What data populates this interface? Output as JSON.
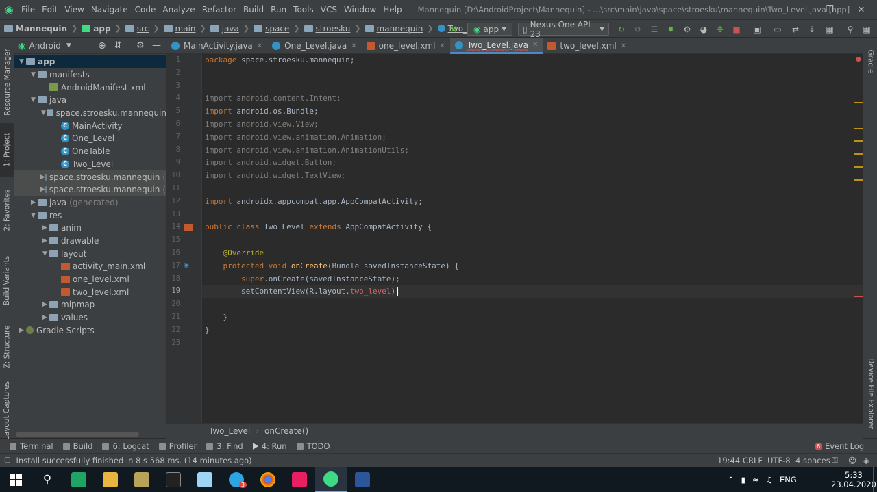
{
  "menubar": {
    "items": [
      "File",
      "Edit",
      "View",
      "Navigate",
      "Code",
      "Analyze",
      "Refactor",
      "Build",
      "Run",
      "Tools",
      "VCS",
      "Window",
      "Help"
    ],
    "window_title": "Mannequin [D:\\AndroidProject\\Mannequin] - ...\\src\\main\\java\\space\\stroesku\\mannequin\\Two_Level.java [app]"
  },
  "navbar": {
    "breadcrumbs": [
      "Mannequin",
      "app",
      "src",
      "main",
      "java",
      "space",
      "stroesku",
      "mannequin",
      "Two_Level"
    ],
    "run_config": "app",
    "device": "Nexus One API 23"
  },
  "sidebar_left": {
    "tabs": [
      "Resource Manager",
      "1: Project",
      "2: Favorites",
      "Build Variants",
      "Z: Structure",
      "Layout Captures"
    ]
  },
  "sidebar_right": {
    "tabs": [
      "Gradle",
      "Device File Explorer"
    ]
  },
  "project": {
    "view_mode": "Android",
    "tree": [
      {
        "label": "app",
        "suffix": "",
        "level": 0,
        "arrow": "down",
        "icon": "folder"
      },
      {
        "label": "manifests",
        "suffix": "",
        "level": 1,
        "arrow": "down",
        "icon": "folder"
      },
      {
        "label": "AndroidManifest.xml",
        "suffix": "",
        "level": 2,
        "arrow": "",
        "icon": "mf"
      },
      {
        "label": "java",
        "suffix": "",
        "level": 1,
        "arrow": "down",
        "icon": "folder"
      },
      {
        "label": "space.stroesku.mannequin",
        "suffix": "",
        "level": 2,
        "arrow": "down",
        "icon": "pkg"
      },
      {
        "label": "MainActivity",
        "suffix": "",
        "level": 3,
        "arrow": "",
        "icon": "cls"
      },
      {
        "label": "One_Level",
        "suffix": "",
        "level": 3,
        "arrow": "",
        "icon": "cls"
      },
      {
        "label": "OneTable",
        "suffix": "",
        "level": 3,
        "arrow": "",
        "icon": "cls"
      },
      {
        "label": "Two_Level",
        "suffix": "",
        "level": 3,
        "arrow": "",
        "icon": "cls"
      },
      {
        "label": "space.stroesku.mannequin",
        "suffix": "(an",
        "level": 2,
        "arrow": "right",
        "icon": "pkg"
      },
      {
        "label": "space.stroesku.mannequin",
        "suffix": "(tes",
        "level": 2,
        "arrow": "right",
        "icon": "pkg"
      },
      {
        "label": "java",
        "suffix": "(generated)",
        "level": 1,
        "arrow": "right",
        "icon": "folder"
      },
      {
        "label": "res",
        "suffix": "",
        "level": 1,
        "arrow": "down",
        "icon": "folder"
      },
      {
        "label": "anim",
        "suffix": "",
        "level": 2,
        "arrow": "right",
        "icon": "folder"
      },
      {
        "label": "drawable",
        "suffix": "",
        "level": 2,
        "arrow": "right",
        "icon": "folder"
      },
      {
        "label": "layout",
        "suffix": "",
        "level": 2,
        "arrow": "down",
        "icon": "folder"
      },
      {
        "label": "activity_main.xml",
        "suffix": "",
        "level": 3,
        "arrow": "",
        "icon": "xml"
      },
      {
        "label": "one_level.xml",
        "suffix": "",
        "level": 3,
        "arrow": "",
        "icon": "xml"
      },
      {
        "label": "two_level.xml",
        "suffix": "",
        "level": 3,
        "arrow": "",
        "icon": "xml"
      },
      {
        "label": "mipmap",
        "suffix": "",
        "level": 2,
        "arrow": "right",
        "icon": "folder"
      },
      {
        "label": "values",
        "suffix": "",
        "level": 2,
        "arrow": "right",
        "icon": "folder"
      },
      {
        "label": "Gradle Scripts",
        "suffix": "",
        "level": 0,
        "arrow": "right",
        "icon": "gr"
      }
    ]
  },
  "editor_tabs": [
    {
      "label": "MainActivity.java",
      "icon": "cls",
      "active": false
    },
    {
      "label": "One_Level.java",
      "icon": "cls",
      "active": false
    },
    {
      "label": "one_level.xml",
      "icon": "xml",
      "active": false
    },
    {
      "label": "Two_Level.java",
      "icon": "cls",
      "active": true
    },
    {
      "label": "two_level.xml",
      "icon": "xml",
      "active": false
    }
  ],
  "code": [
    [
      [
        "kw",
        "package "
      ],
      [
        "",
        "space.stroesku.mannequin;"
      ]
    ],
    [],
    [],
    [
      [
        "gr",
        "import android.content.Intent;"
      ]
    ],
    [
      [
        "kw",
        "import "
      ],
      [
        "",
        "android.os.Bundle;"
      ]
    ],
    [
      [
        "gr",
        "import android.view.View;"
      ]
    ],
    [
      [
        "gr",
        "import android.view.animation.Animation;"
      ]
    ],
    [
      [
        "gr",
        "import android.view.animation.AnimationUtils;"
      ]
    ],
    [
      [
        "gr",
        "import android.widget.Button;"
      ]
    ],
    [
      [
        "gr",
        "import android.widget.TextView;"
      ]
    ],
    [],
    [
      [
        "kw",
        "import "
      ],
      [
        "",
        "androidx.appcompat.app.AppCompatActivity;"
      ]
    ],
    [],
    [
      [
        "kw",
        "public class "
      ],
      [
        "",
        "Two_Level "
      ],
      [
        "kw",
        "extends "
      ],
      [
        "",
        "AppCompatActivity {"
      ]
    ],
    [],
    [
      [
        "an",
        "    @Override"
      ]
    ],
    [
      [
        "kw",
        "    protected void "
      ],
      [
        "fn",
        "onCreate"
      ],
      [
        "",
        "(Bundle savedInstanceState) {"
      ]
    ],
    [
      [
        "kw",
        "        super"
      ],
      [
        "",
        ".onCreate(savedInstanceState);"
      ]
    ],
    [
      [
        "",
        "        setContentView(R.layout."
      ],
      [
        "red",
        "two_level"
      ],
      [
        "",
        ");"
      ]
    ],
    [],
    [
      [
        "",
        "    }"
      ]
    ],
    [
      [
        "",
        "}"
      ]
    ],
    []
  ],
  "current_line": 19,
  "breadcrumb_bottom": [
    "Two_Level",
    "onCreate()"
  ],
  "tool_windows": [
    "Terminal",
    "Build",
    "6: Logcat",
    "Profiler",
    "3: Find",
    "4: Run",
    "TODO"
  ],
  "event_log": {
    "count": "6",
    "label": "Event Log"
  },
  "status": {
    "message": "Install successfully finished in 8 s 568 ms. (14 minutes ago)",
    "position": "19:44",
    "line_sep": "CRLF",
    "encoding": "UTF-8",
    "indent": "4 spaces"
  },
  "taskbar": {
    "lang": "ENG",
    "time": "5:33",
    "date": "23.04.2020",
    "telegram_badge": "3"
  }
}
